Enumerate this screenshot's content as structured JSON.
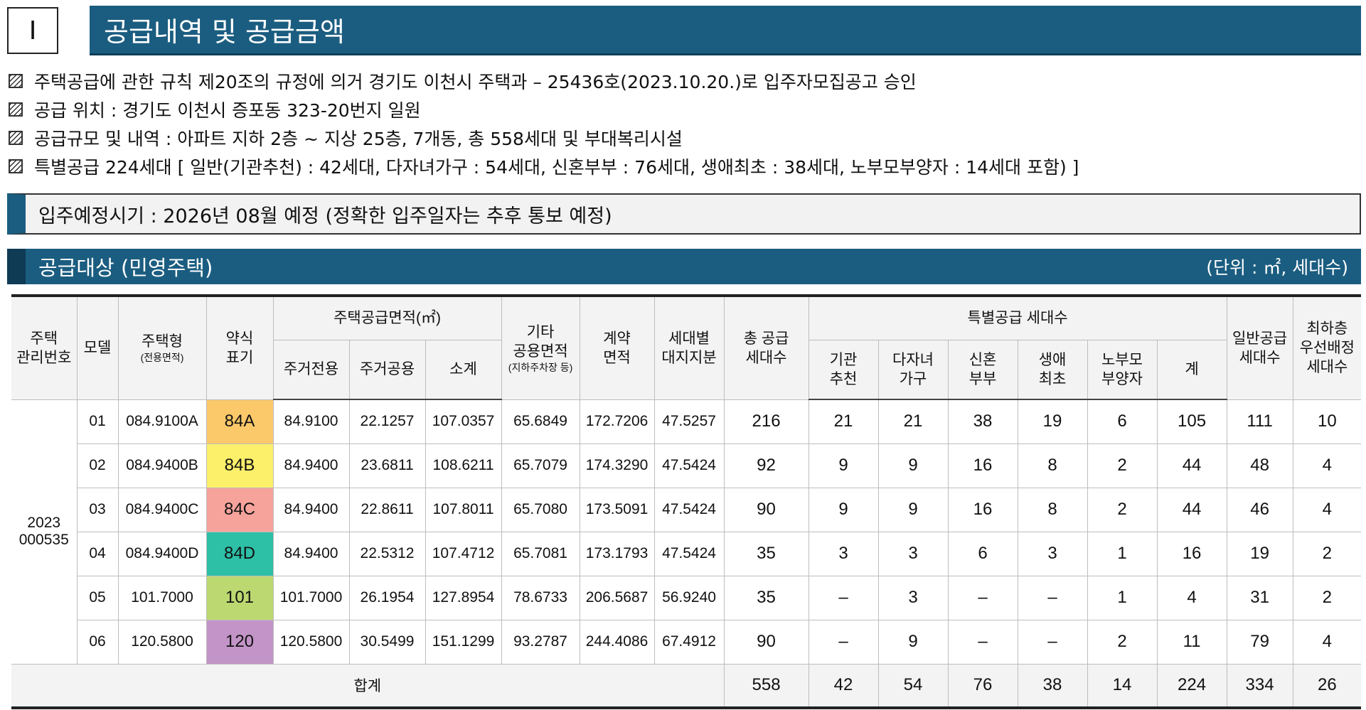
{
  "section": {
    "number": "Ⅰ",
    "title": "공급내역 및 공급금액"
  },
  "bullets": [
    "주택공급에 관한 규칙 제20조의 규정에 의거 경기도 이천시 주택과 – 25436호(2023.10.20.)로 입주자모집공고 승인",
    "공급 위치 : 경기도 이천시 증포동 323-20번지 일원",
    "공급규모 및 내역 : 아파트 지하 2층 ~ 지상 25층, 7개동, 총 558세대 및 부대복리시설",
    "특별공급 224세대 [ 일반(기관추천) : 42세대, 다자녀가구 : 54세대, 신혼부부 : 76세대, 생애최초 : 38세대, 노부모부양자 : 14세대 포함) ]"
  ],
  "notice": "입주예정시기 : 2026년 08월 예정 (정확한 입주일자는 추후 통보 예정)",
  "subheader": {
    "title": "공급대상 (민영주택)",
    "unit": "(단위 : ㎡, 세대수)"
  },
  "table": {
    "headers": {
      "mgmt_no": [
        "주택",
        "관리번호"
      ],
      "model": "모델",
      "type": "주택형",
      "type_sub": "(전용면적)",
      "abbr": [
        "약식",
        "표기"
      ],
      "supply_area": "주택공급면적(㎡)",
      "exclusive": "주거전용",
      "common": "주거공용",
      "subtotal": "소계",
      "other": [
        "기타",
        "공용면적"
      ],
      "other_sub": "(지하주차장 등)",
      "contract": [
        "계약",
        "면적"
      ],
      "land": [
        "세대별",
        "대지지분"
      ],
      "total_supply": [
        "총 공급",
        "세대수"
      ],
      "special": "특별공급 세대수",
      "institution": [
        "기관",
        "추천"
      ],
      "multichild": [
        "다자녀",
        "가구"
      ],
      "newlywed": [
        "신혼",
        "부부"
      ],
      "firsttime": [
        "생애",
        "최초"
      ],
      "elderly": [
        "노부모",
        "부양자"
      ],
      "special_total": "계",
      "general": [
        "일반공급",
        "세대수"
      ],
      "lowest": [
        "최하층",
        "우선배정",
        "세대수"
      ]
    },
    "mgmt_no_value": [
      "2023",
      "000535"
    ],
    "rows": [
      {
        "model": "01",
        "type": "084.9100A",
        "abbr": "84A",
        "color": "#fcc96a",
        "exclusive": "84.9100",
        "common": "22.1257",
        "subtotal": "107.0357",
        "other": "65.6849",
        "contract": "172.7206",
        "land": "47.5257",
        "total": "216",
        "institution": "21",
        "multichild": "21",
        "newlywed": "38",
        "firsttime": "19",
        "elderly": "6",
        "special_total": "105",
        "general": "111",
        "lowest": "10"
      },
      {
        "model": "02",
        "type": "084.9400B",
        "abbr": "84B",
        "color": "#fcef6a",
        "exclusive": "84.9400",
        "common": "23.6811",
        "subtotal": "108.6211",
        "other": "65.7079",
        "contract": "174.3290",
        "land": "47.5424",
        "total": "92",
        "institution": "9",
        "multichild": "9",
        "newlywed": "16",
        "firsttime": "8",
        "elderly": "2",
        "special_total": "44",
        "general": "48",
        "lowest": "4"
      },
      {
        "model": "03",
        "type": "084.9400C",
        "abbr": "84C",
        "color": "#f6a39b",
        "exclusive": "84.9400",
        "common": "22.8611",
        "subtotal": "107.8011",
        "other": "65.7080",
        "contract": "173.5091",
        "land": "47.5424",
        "total": "90",
        "institution": "9",
        "multichild": "9",
        "newlywed": "16",
        "firsttime": "8",
        "elderly": "2",
        "special_total": "44",
        "general": "46",
        "lowest": "4"
      },
      {
        "model": "04",
        "type": "084.9400D",
        "abbr": "84D",
        "color": "#2ebfa7",
        "exclusive": "84.9400",
        "common": "22.5312",
        "subtotal": "107.4712",
        "other": "65.7081",
        "contract": "173.1793",
        "land": "47.5424",
        "total": "35",
        "institution": "3",
        "multichild": "3",
        "newlywed": "6",
        "firsttime": "3",
        "elderly": "1",
        "special_total": "16",
        "general": "19",
        "lowest": "2"
      },
      {
        "model": "05",
        "type": "101.7000",
        "abbr": "101",
        "color": "#bcd870",
        "exclusive": "101.7000",
        "common": "26.1954",
        "subtotal": "127.8954",
        "other": "78.6733",
        "contract": "206.5687",
        "land": "56.9240",
        "total": "35",
        "institution": "–",
        "multichild": "3",
        "newlywed": "–",
        "firsttime": "–",
        "elderly": "1",
        "special_total": "4",
        "general": "31",
        "lowest": "2"
      },
      {
        "model": "06",
        "type": "120.5800",
        "abbr": "120",
        "color": "#c394c8",
        "exclusive": "120.5800",
        "common": "30.5499",
        "subtotal": "151.1299",
        "other": "93.2787",
        "contract": "244.4086",
        "land": "67.4912",
        "total": "90",
        "institution": "–",
        "multichild": "9",
        "newlywed": "–",
        "firsttime": "–",
        "elderly": "2",
        "special_total": "11",
        "general": "79",
        "lowest": "4"
      }
    ],
    "totals": {
      "label": "합계",
      "total": "558",
      "institution": "42",
      "multichild": "54",
      "newlywed": "76",
      "firsttime": "38",
      "elderly": "14",
      "special_total": "224",
      "general": "334",
      "lowest": "26"
    }
  }
}
